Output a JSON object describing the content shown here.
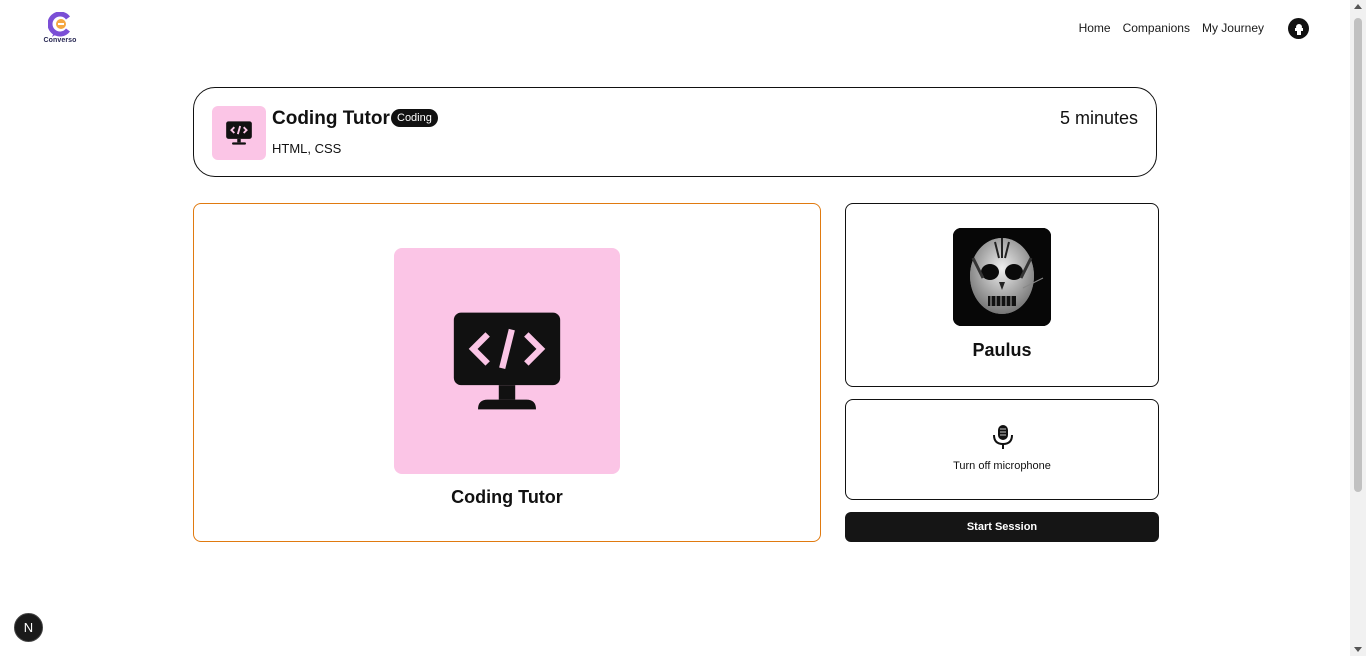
{
  "brand": {
    "name": "Converso",
    "accent": "#7b4fd6"
  },
  "nav": {
    "items": [
      "Home",
      "Companions",
      "My Journey"
    ]
  },
  "session": {
    "companion_name": "Coding Tutor",
    "subject": "Coding",
    "topic": "HTML, CSS",
    "duration": "5 minutes",
    "icon": "code-monitor-icon",
    "icon_bg": "#fbc5e6",
    "card_border": "#e07a10"
  },
  "user": {
    "name": "Paulus"
  },
  "controls": {
    "mic_label": "Turn off microphone",
    "start_label": "Start Session"
  },
  "dev_badge": {
    "letter": "N"
  }
}
